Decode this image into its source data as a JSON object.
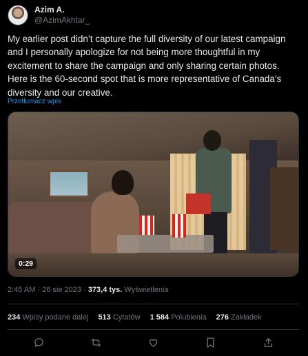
{
  "author": {
    "display_name": "Azim A.",
    "handle": "@AzimAkhtar_"
  },
  "tweet": {
    "text": "My earlier post didn’t capture the full diversity of our latest campaign and I personally apologize for not being more thoughtful in my excitement to share the campaign and only sharing certain photos. Here is the 60-second spot that is more representative of Canada’s diversity and our creative.",
    "translate_label": "Przetłumacz wpis"
  },
  "media": {
    "duration": "0:29"
  },
  "meta": {
    "time": "2:45 AM",
    "separator1": " · ",
    "date": "26 sie 2023",
    "separator2": " · ",
    "views_count": "373,4 tys.",
    "views_label": " Wyświetlenia"
  },
  "stats": [
    {
      "value": "234",
      "label": "Wpisy podane dalej"
    },
    {
      "value": "513",
      "label": "Cytatów"
    },
    {
      "value": "1 584",
      "label": "Polubienia"
    },
    {
      "value": "276",
      "label": "Zakładek"
    }
  ],
  "actions": [
    "reply-icon",
    "repost-icon",
    "like-icon",
    "bookmark-icon",
    "share-icon"
  ],
  "colors": {
    "background": "#000000",
    "text": "#e7e9ea",
    "secondary": "#71767b",
    "link": "#1d9bf0",
    "border": "#2f3336"
  }
}
